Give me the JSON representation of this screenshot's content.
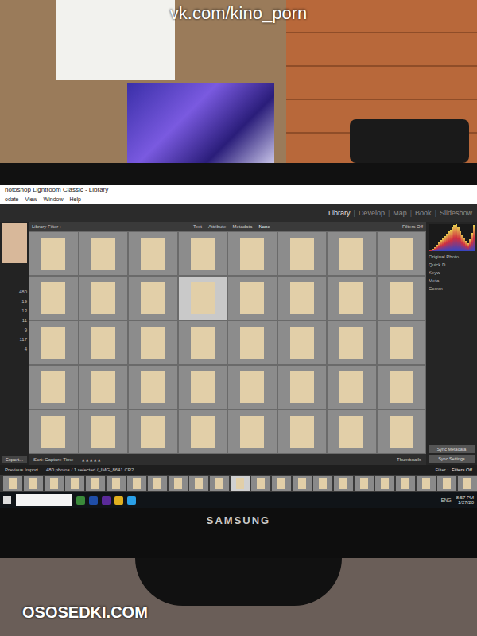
{
  "watermarks": {
    "top": "vk.com/kino_porn",
    "bottom": "OSOSEDKI.COM"
  },
  "window": {
    "title": "hotoshop Lightroom Classic - Library",
    "menu": [
      "odate",
      "View",
      "Window",
      "Help"
    ]
  },
  "modules": [
    {
      "label": "Library",
      "selected": true
    },
    {
      "label": "Develop",
      "selected": false
    },
    {
      "label": "Map",
      "selected": false
    },
    {
      "label": "Book",
      "selected": false
    },
    {
      "label": "Slideshow",
      "selected": false
    }
  ],
  "filter_bar": {
    "label": "Library Filter :",
    "options": [
      {
        "label": "Text",
        "selected": false
      },
      {
        "label": "Attribute",
        "selected": false
      },
      {
        "label": "Metadata",
        "selected": false
      },
      {
        "label": "None",
        "selected": true
      }
    ],
    "preset": "Filters Off"
  },
  "left_panel": {
    "counts": [
      "480",
      "19",
      "13",
      "11",
      "9",
      "117",
      "4"
    ],
    "export": "Export..."
  },
  "right_panel": {
    "histogram": [
      2,
      4,
      8,
      14,
      22,
      30,
      38,
      44,
      52,
      60,
      68,
      72,
      80,
      88,
      92,
      84,
      70,
      58,
      46,
      36,
      28,
      40,
      62,
      90
    ],
    "photo_label": "Original Photo",
    "sections": [
      "Quick D",
      "Keyw",
      "Meta",
      "Comm"
    ]
  },
  "grid": {
    "cells": [
      {
        "selected": false
      },
      {
        "selected": false
      },
      {
        "selected": false
      },
      {
        "selected": false
      },
      {
        "selected": false
      },
      {
        "selected": false
      },
      {
        "selected": false
      },
      {
        "selected": false
      },
      {
        "selected": false
      },
      {
        "selected": false
      },
      {
        "selected": false
      },
      {
        "selected": true
      },
      {
        "selected": false
      },
      {
        "selected": false
      },
      {
        "selected": false
      },
      {
        "selected": false
      },
      {
        "selected": false
      },
      {
        "selected": false
      },
      {
        "selected": false
      },
      {
        "selected": false
      },
      {
        "selected": false
      },
      {
        "selected": false
      },
      {
        "selected": false
      },
      {
        "selected": false
      },
      {
        "selected": false
      },
      {
        "selected": false
      },
      {
        "selected": false
      },
      {
        "selected": false
      },
      {
        "selected": false
      },
      {
        "selected": false
      },
      {
        "selected": false
      },
      {
        "selected": false
      },
      {
        "selected": false
      },
      {
        "selected": false
      },
      {
        "selected": false
      },
      {
        "selected": false
      },
      {
        "selected": false
      },
      {
        "selected": false
      },
      {
        "selected": false
      },
      {
        "selected": false
      }
    ]
  },
  "toolbar": {
    "sort": "Sort: Capture Time",
    "stars": "★★★★★",
    "view": "Thumbnails",
    "sync": [
      "Sync Metadata",
      "Sync Settings"
    ]
  },
  "filmstrip": {
    "source": "Previous Import",
    "info": "480 photos / 1 selected /_IMG_8641.CR2",
    "filter_label": "Filter :",
    "filter_value": "Filters Off",
    "thumbs": [
      {
        "selected": false
      },
      {
        "selected": false
      },
      {
        "selected": false
      },
      {
        "selected": false
      },
      {
        "selected": false
      },
      {
        "selected": false
      },
      {
        "selected": false
      },
      {
        "selected": false
      },
      {
        "selected": false
      },
      {
        "selected": false
      },
      {
        "selected": false
      },
      {
        "selected": true
      },
      {
        "selected": false
      },
      {
        "selected": false
      },
      {
        "selected": false
      },
      {
        "selected": false
      },
      {
        "selected": false
      },
      {
        "selected": false
      },
      {
        "selected": false
      },
      {
        "selected": false
      },
      {
        "selected": false
      },
      {
        "selected": false
      },
      {
        "selected": false
      }
    ]
  },
  "taskbar": {
    "tray": "ENG",
    "time": "8:57 PM",
    "date": "1/27/20"
  },
  "monitor": {
    "brand": "SAMSUNG"
  }
}
